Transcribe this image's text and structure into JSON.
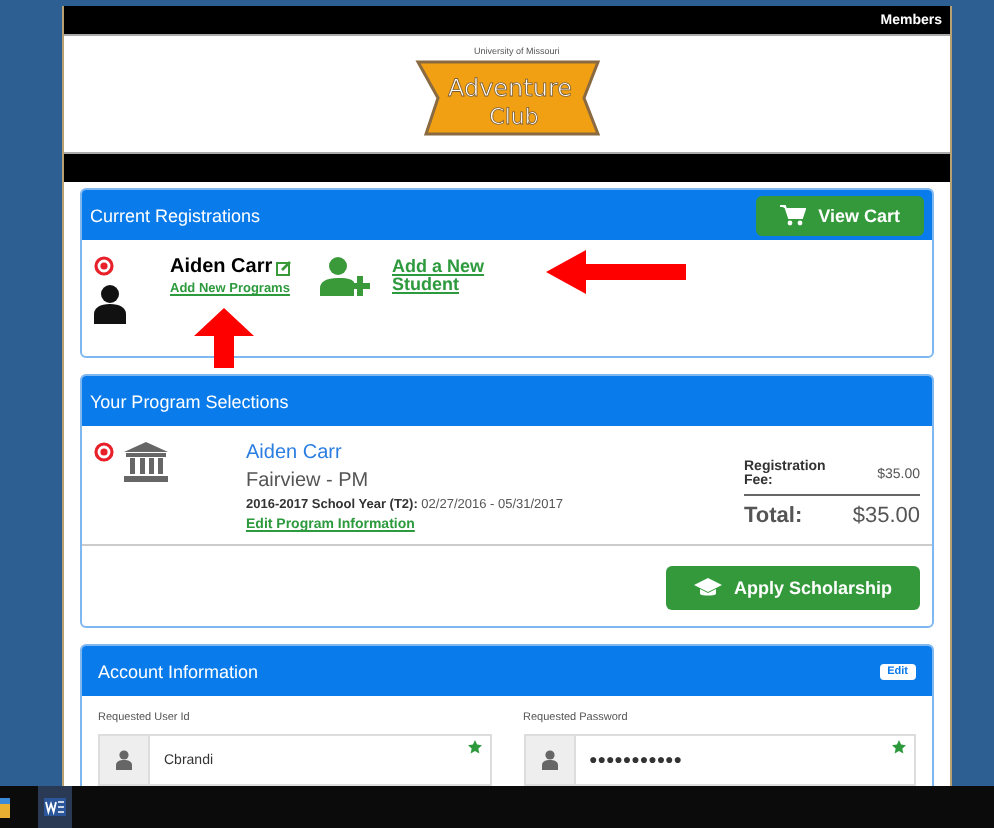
{
  "header": {
    "link": "Members"
  },
  "logo": {
    "tagline": "University of Missouri",
    "title_1": "Adventure",
    "title_2": "Club"
  },
  "registrations": {
    "title": "Current Registrations",
    "cart_button": "View Cart",
    "student": {
      "name": "Aiden Carr",
      "link": "Add New Programs"
    },
    "add_student": "Add a New Student"
  },
  "selections": {
    "title": "Your Program Selections",
    "item": {
      "student": "Aiden Carr",
      "program": "Fairview - PM",
      "schedule": "**2016-2017 School Year (T2):** 02/27/2016 - 05/31/2017",
      "edit_link": "Edit Program Information",
      "fee_label": "Registration Fee:",
      "fee": "$35.00",
      "total_label": "Total:",
      "total": "$35.00"
    },
    "button": "Apply Scholarship"
  },
  "account": {
    "title": "Account Information",
    "edit_button": "Edit",
    "fields": [
      {
        "label": "Requested User Id",
        "value": "Cbrandi",
        "required": true
      },
      {
        "label": "Requested Password",
        "value": "●●●●●●●●●●●",
        "required": true
      }
    ]
  }
}
